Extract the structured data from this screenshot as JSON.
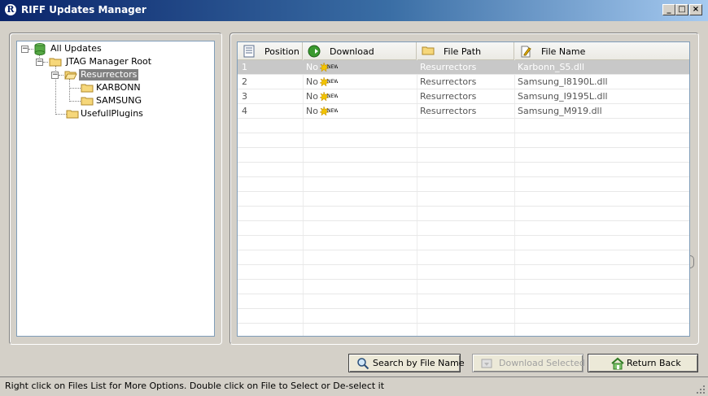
{
  "window": {
    "title": "RIFF Updates Manager",
    "icon_letter": "R",
    "minimize": "_",
    "maximize": "□",
    "close": "×"
  },
  "tree": {
    "root": "All Updates",
    "jtag_root": "JTAG Manager Root",
    "resurrectors": "Resurrectors",
    "karbonn": "KARBONN",
    "samsung": "SAMSUNG",
    "usefull_plugins": "UsefullPlugins",
    "selected": "Resurrectors"
  },
  "grid": {
    "columns": [
      "Position",
      "Download",
      "File Path",
      "File Name"
    ],
    "rows": [
      {
        "position": "1",
        "download": "No",
        "file_path": "Resurrectors",
        "file_name": "Karbonn_S5.dll",
        "selected": true
      },
      {
        "position": "2",
        "download": "No",
        "file_path": "Resurrectors",
        "file_name": "Samsung_I8190L.dll",
        "selected": false
      },
      {
        "position": "3",
        "download": "No",
        "file_path": "Resurrectors",
        "file_name": "Samsung_I9195L.dll",
        "selected": false
      },
      {
        "position": "4",
        "download": "No",
        "file_path": "Resurrectors",
        "file_name": "Samsung_M919.dll",
        "selected": false
      }
    ],
    "new_badge": "NEW"
  },
  "buttons": {
    "search": "Search by File Name",
    "download": "Download Selected",
    "return": "Return Back"
  },
  "status": "Right click on Files List for More Options. Double click on File to Select or De-select it",
  "colors": {
    "title_start": "#0a246a",
    "title_end": "#a6caf0",
    "selection": "#808080",
    "face": "#d4d0c8"
  }
}
